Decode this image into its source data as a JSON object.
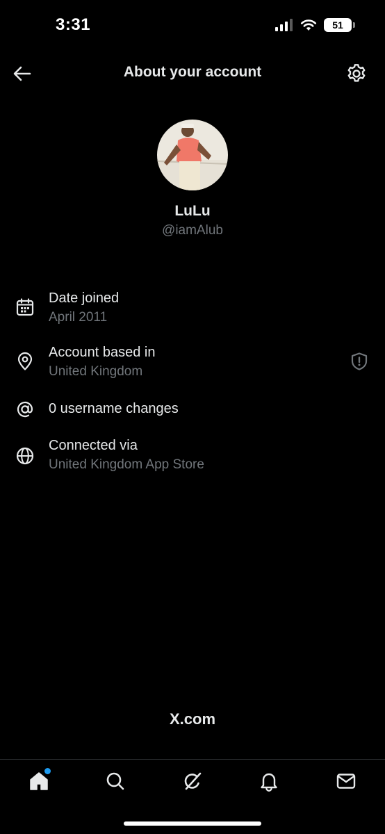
{
  "status_bar": {
    "time": "3:31",
    "battery": "51"
  },
  "header": {
    "title": "About your account"
  },
  "profile": {
    "display_name": "LuLu",
    "handle": "@iamAlub"
  },
  "info": {
    "date_joined": {
      "title": "Date joined",
      "value": "April 2011",
      "icon": "calendar-icon"
    },
    "account_based": {
      "title": "Account based in",
      "value": "United Kingdom",
      "icon": "location-pin-icon"
    },
    "username_changes": {
      "title": "0 username changes",
      "icon": "at-sign-icon"
    },
    "connected_via": {
      "title": "Connected via",
      "value": "United Kingdom App Store",
      "icon": "globe-icon"
    }
  },
  "footer": {
    "brand": "X.com"
  },
  "tab_bar": {
    "tabs": [
      "home-icon",
      "search-icon",
      "grok-icon",
      "bell-icon",
      "mail-icon"
    ]
  },
  "colors": {
    "background": "#000000",
    "text_primary": "#e7e9ea",
    "text_secondary": "#71767b",
    "accent": "#1d9bf0",
    "divider": "#2f3336"
  }
}
